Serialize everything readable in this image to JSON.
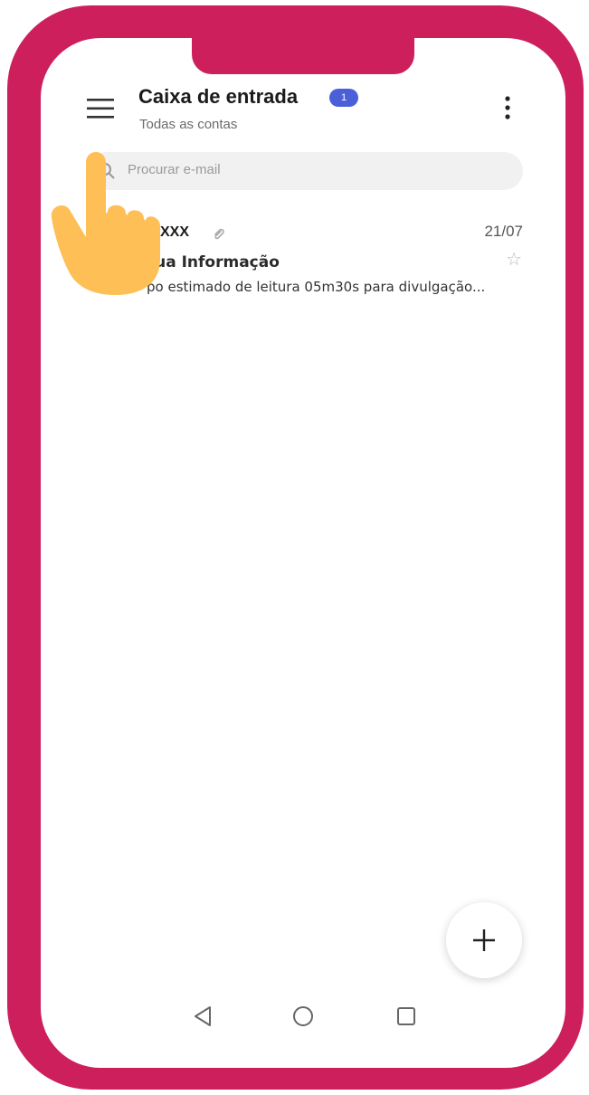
{
  "header": {
    "title": "Caixa de entrada",
    "unread_badge": "1",
    "subtitle": "Todas as contas"
  },
  "search": {
    "placeholder": "Procurar e-mail"
  },
  "emails": [
    {
      "sender": "XXX",
      "date": "21/07",
      "subject": "sua Informação",
      "preview": "po estimado de leitura 05m30s para divulgação..."
    }
  ],
  "colors": {
    "frame": "#cc1f5c",
    "badge": "#4a5fd8",
    "hand": "#fdbf56"
  },
  "icons": {
    "menu": "hamburger-icon",
    "more": "kebab-icon",
    "search": "search-icon",
    "attachment": "paperclip-icon",
    "star": "star-icon",
    "compose": "plus-icon",
    "pointer": "hand-pointer-icon",
    "nav": [
      "back-icon",
      "home-icon",
      "recents-icon"
    ]
  }
}
